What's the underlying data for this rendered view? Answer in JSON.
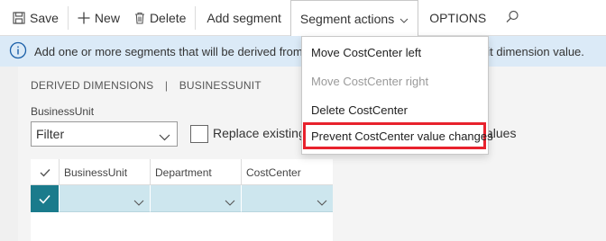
{
  "toolbar": {
    "save_label": "Save",
    "new_label": "New",
    "delete_label": "Delete",
    "add_segment_label": "Add segment",
    "segment_actions_label": "Segment actions",
    "options_label": "OPTIONS"
  },
  "infobar": {
    "message_left": "Add one or more segments that will be derived from Bu",
    "message_right": "nit dimension value."
  },
  "breadcrumb": {
    "part1": "DERIVED DIMENSIONS",
    "separator": "|",
    "part2": "BUSINESSUNIT"
  },
  "filter": {
    "label": "BusinessUnit",
    "value": "Filter"
  },
  "replace": {
    "label": "Replace existing",
    "label_tail": "alues"
  },
  "grid": {
    "columns": [
      "BusinessUnit",
      "Department",
      "CostCenter"
    ]
  },
  "menu": {
    "items": [
      {
        "label": "Move CostCenter left",
        "enabled": true
      },
      {
        "label": "Move CostCenter right",
        "enabled": false
      },
      {
        "label": "Delete CostCenter",
        "enabled": true
      },
      {
        "label": "Prevent CostCenter value changes",
        "enabled": true,
        "highlighted": true
      }
    ]
  },
  "colors": {
    "accent": "#1a7b8c",
    "info_bg": "#dbeaf7",
    "highlight_border": "#e8222d",
    "grid_row": "#cde6ee"
  }
}
